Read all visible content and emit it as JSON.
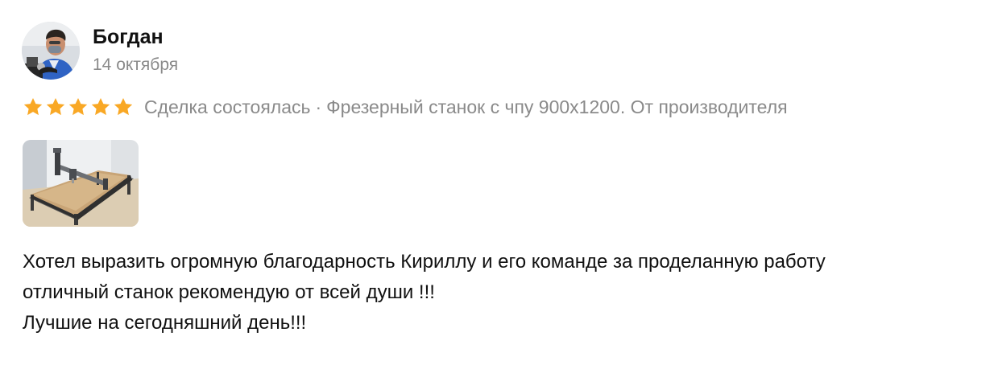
{
  "author": {
    "name": "Богдан",
    "date": "14 октября",
    "avatar_icon": "user-photo"
  },
  "rating": {
    "stars": 5,
    "max": 5,
    "star_color": "#f9a825"
  },
  "deal": {
    "status": "Сделка состоялась",
    "separator": "·",
    "ad_title": "Фрезерный станок с чпу 900х1200. От производителя"
  },
  "photo": {
    "icon": "cnc-machine-photo"
  },
  "review": {
    "lines": [
      "Хотел выразить огромную благодарность Кириллу и его команде за проделанную работу",
      "отличный станок рекомендую от всей души !!!",
      "Лучшие на сегодняшний день!!!"
    ]
  },
  "colors": {
    "text_primary": "#111111",
    "text_secondary": "#8a8a8a",
    "star": "#f9a825"
  }
}
